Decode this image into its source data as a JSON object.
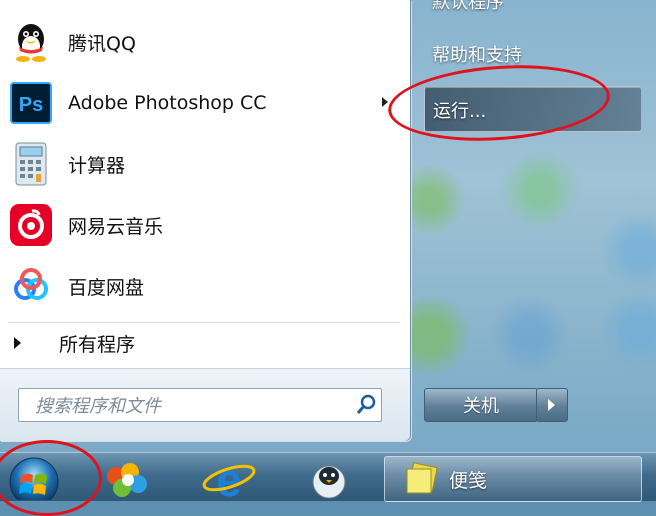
{
  "start_menu": {
    "programs": [
      {
        "label": "腾讯QQ",
        "icon": "qq-penguin-icon"
      },
      {
        "label": "Adobe Photoshop CC",
        "icon": "photoshop-icon",
        "has_submenu": true
      },
      {
        "label": "计算器",
        "icon": "calculator-icon"
      },
      {
        "label": "网易云音乐",
        "icon": "netease-music-icon"
      },
      {
        "label": "百度网盘",
        "icon": "baidu-netdisk-icon"
      }
    ],
    "all_programs_label": "所有程序",
    "search": {
      "placeholder": "搜索程序和文件",
      "icon": "search-icon"
    },
    "right_pane": {
      "top_partial_label": "默认程序",
      "help_label": "帮助和支持",
      "run_label": "运行...",
      "shutdown_label": "关机"
    }
  },
  "taskbar": {
    "start_button": "windows-start-orb-icon",
    "pinned": [
      "paint-icon",
      "internet-explorer-icon",
      "penguin-app-icon"
    ],
    "active_window": {
      "label": "便笺",
      "icon": "sticky-notes-icon"
    }
  },
  "annotations": {
    "highlight_color": "#e0121c"
  }
}
